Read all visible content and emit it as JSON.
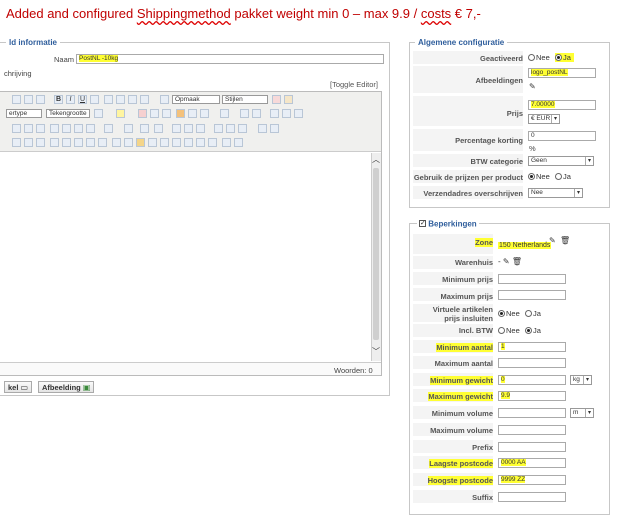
{
  "title": {
    "part1": "Added and configured ",
    "part2": "Shippingmethod",
    "part3": "  pakket weight min 0 – max 9.9   / ",
    "part4": "costs",
    "part5": " € 7,-"
  },
  "left": {
    "legend": "ld informatie",
    "name_label": "Naam",
    "name_value": "PostNL -10kg",
    "description_label": "chrijving",
    "toggle_editor": "[Toggle Editor]",
    "toolbar": {
      "format_select": "Opmaak",
      "styles_select": "Stijlen",
      "fonttype_select": "ertype",
      "fontsize_select": "Tekengrootte"
    },
    "words_label": "Woorden: 0",
    "btn_article": "kel",
    "btn_image": "Afbeelding"
  },
  "config": {
    "legend": "Algemene configuratie",
    "active_label": "Geactiveerd",
    "active_no": "Nee",
    "active_yes": "Ja",
    "images_label": "Afbeeldingen",
    "images_value": "logo_postNL",
    "price_label": "Prijs",
    "price_value": "7.00000",
    "currency": "€ EUR",
    "discount_label": "Percentage korting",
    "discount_value": "0",
    "discount_unit": "%",
    "vat_label": "BTW categorie",
    "vat_value": "Geen",
    "use_product_prices_label": "Gebruik de prijzen per product",
    "use_no": "Nee",
    "use_yes": "Ja",
    "override_address_label": "Verzendadres overschrijven",
    "override_value": "Nee"
  },
  "restrictions": {
    "legend": "Beperkingen",
    "zone_label": "Zone",
    "zone_value": "150 Netherlands",
    "warehouse_label": "Warenhuis",
    "warehouse_value": "-",
    "min_price_label": "Minimum prijs",
    "max_price_label": "Maximum prijs",
    "virtual_label_1": "Virtuele artikelen",
    "virtual_label_2": "prijs insluiten",
    "virtual_no": "Nee",
    "virtual_yes": "Ja",
    "incl_vat_label": "Incl. BTW",
    "incl_no": "Nee",
    "incl_yes": "Ja",
    "min_qty_label": "Minimum aantal",
    "min_qty_value": "1",
    "max_qty_label": "Maximum aantal",
    "min_weight_label": "Minimum gewicht",
    "min_weight_value": "0",
    "weight_unit": "kg",
    "max_weight_label": "Maximum gewicht",
    "max_weight_value": "9.9",
    "min_volume_label": "Minimum volume",
    "volume_unit": "m",
    "max_volume_label": "Maximum volume",
    "prefix_label": "Prefix",
    "lowest_postcode_label": "Laagste postcode",
    "lowest_postcode_value": "0000 AA",
    "highest_postcode_label": "Hoogste postcode",
    "highest_postcode_value": "9999 ZZ",
    "suffix_label": "Suffix"
  }
}
